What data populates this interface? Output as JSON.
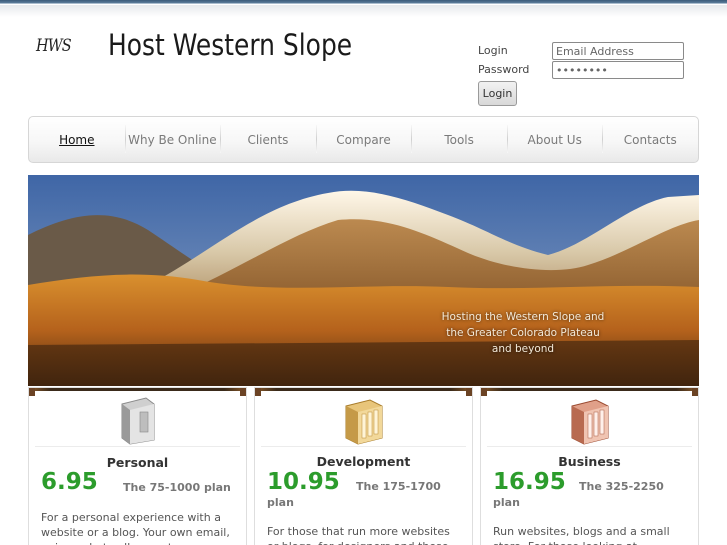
{
  "header": {
    "logo_mark": "HWS",
    "title": "Host Western Slope"
  },
  "login": {
    "login_label": "Login",
    "password_label": "Password",
    "email_value": "Email Address",
    "password_value": "••••••••",
    "button_label": "Login"
  },
  "nav": {
    "items": [
      {
        "label": "Home"
      },
      {
        "label": "Why Be Online"
      },
      {
        "label": "Clients"
      },
      {
        "label": "Compare"
      },
      {
        "label": "Tools"
      },
      {
        "label": "About Us"
      },
      {
        "label": "Contacts"
      }
    ],
    "active": "Home"
  },
  "hero": {
    "caption_line1": "Hosting the Western Slope and",
    "caption_line2": "the Greater Colorado Plateau",
    "caption_line3": "and beyond"
  },
  "plans": [
    {
      "title": "Personal",
      "price": "6.95",
      "plan": "The 75-1000 plan",
      "desc": "For a personal experience with a website or a blog.  Your own email, unique photo albums etc",
      "icon": "server-silver-icon",
      "icon_color": "#b8b8b8"
    },
    {
      "title": "Development",
      "price": "10.95",
      "plan": "The 175-1700",
      "plan_line2": "plan",
      "desc": "For those that run more websites or blogs, for designers and those",
      "icon": "server-gold-icon",
      "icon_color": "#d4a64a"
    },
    {
      "title": "Business",
      "price": "16.95",
      "plan": "The 325-2250",
      "plan_line2": "plan",
      "desc": "Run websites, blogs and a small store.  For those looking at",
      "icon": "server-copper-icon",
      "icon_color": "#c9755a"
    }
  ],
  "colors": {
    "price_green": "#2c9c2c",
    "nav_text": "#7a7a7a",
    "topbar": "#3a5a78"
  }
}
